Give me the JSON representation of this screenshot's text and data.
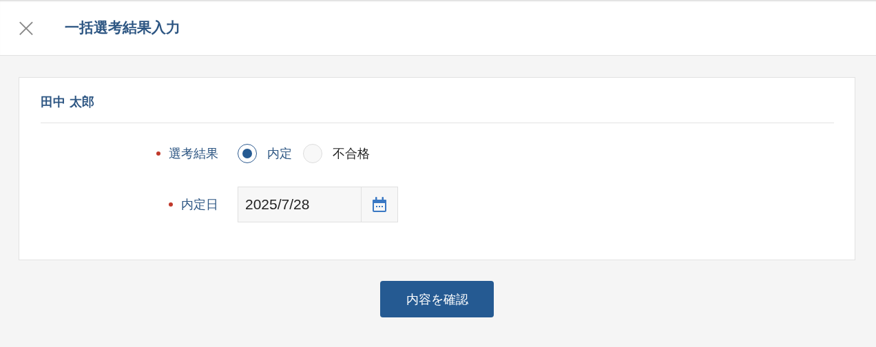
{
  "header": {
    "close": "×",
    "title": "一括選考結果入力"
  },
  "candidate": {
    "name": "田中 太郎"
  },
  "fields": [
    {
      "kind": "radio",
      "label": "選考結果",
      "required": true,
      "options": [
        {
          "label": "内定",
          "selected": true
        },
        {
          "label": "不合格",
          "selected": false
        }
      ]
    },
    {
      "kind": "date",
      "label": "内定日",
      "required": true,
      "value": "2025/7/28"
    }
  ],
  "confirm_button": "内容を確認"
}
